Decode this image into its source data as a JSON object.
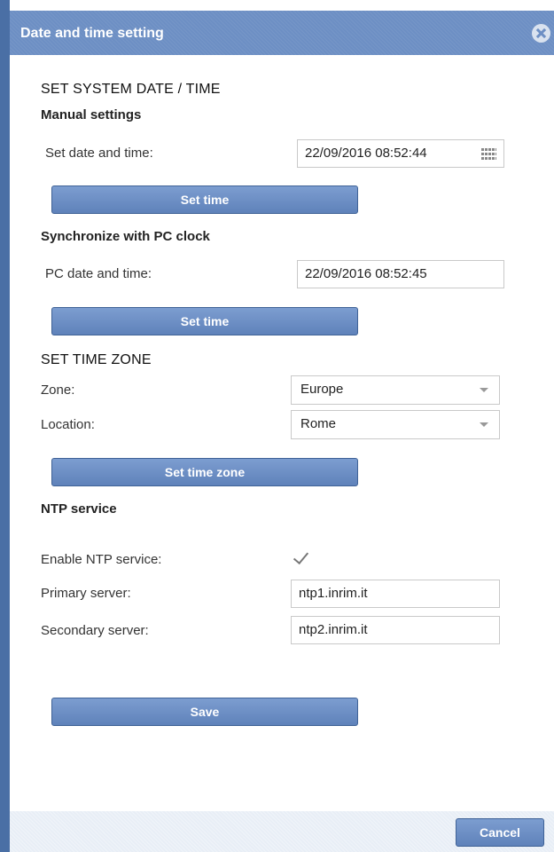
{
  "dialog": {
    "title": "Date and time setting"
  },
  "system_datetime": {
    "heading": "SET SYSTEM DATE / TIME",
    "manual": {
      "heading": "Manual settings",
      "label": "Set date and time:",
      "value": "22/09/2016 08:52:44",
      "button": "Set time"
    },
    "pc_sync": {
      "heading": "Synchronize with PC clock",
      "label": "PC date and time:",
      "value": "22/09/2016 08:52:45",
      "button": "Set time"
    }
  },
  "time_zone": {
    "heading": "SET TIME ZONE",
    "zone_label": "Zone:",
    "zone_value": "Europe",
    "location_label": "Location:",
    "location_value": "Rome",
    "button": "Set time zone"
  },
  "ntp": {
    "heading": "NTP service",
    "enable_label": "Enable NTP service:",
    "enabled": true,
    "primary_label": "Primary server:",
    "primary_value": "ntp1.inrim.it",
    "secondary_label": "Secondary server:",
    "secondary_value": "ntp2.inrim.it"
  },
  "actions": {
    "save": "Save",
    "cancel": "Cancel"
  },
  "icons": {
    "close": "close-icon",
    "calendar": "calendar-icon",
    "dropdown": "chevron-down-icon",
    "check": "checkmark-icon"
  },
  "colors": {
    "titlebar": "#6d8fc4",
    "button": "#6b8ec6",
    "accent_edge": "#4a6fa5"
  }
}
